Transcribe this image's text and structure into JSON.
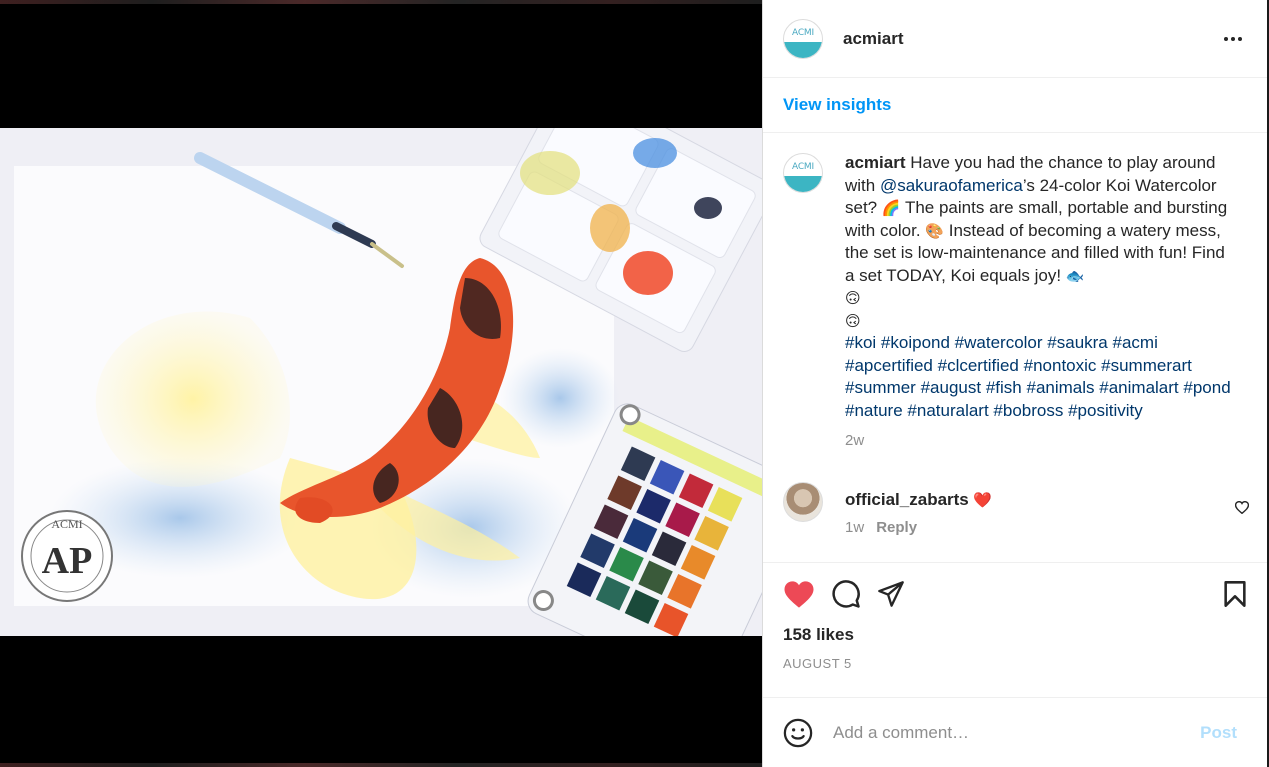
{
  "account": {
    "username": "acmiart",
    "avatar_text": "ACMI"
  },
  "insights": {
    "label": "View insights"
  },
  "caption": {
    "username": "acmiart",
    "text_1": " Have you had the chance to play around with ",
    "mention": "@sakuraofamerica",
    "text_2": "’s 24-color Koi Watercolor set? ",
    "emoji_rainbow": "🌈",
    "text_3": " The paints are small, portable and bursting with color. ",
    "emoji_palette": "🎨",
    "text_4": " Instead of becoming a watery mess, the set is low-maintenance and filled with fun! Find a set TODAY, Koi equals joy! ",
    "emoji_fish": "🐟",
    "emoji_line_1": "🙃",
    "emoji_line_2": "🙃",
    "hashtags": [
      "#koi",
      "#koipond",
      "#watercolor",
      "#saukra",
      "#acmi",
      "#apcertified",
      "#clcertified",
      "#nontoxic",
      "#summerart",
      "#summer",
      "#august",
      "#fish",
      "#animals",
      "#animalart",
      "#pond",
      "#nature",
      "#naturalart",
      "#bobross",
      "#positivity"
    ],
    "time_ago": "2w"
  },
  "comment": {
    "username": "official_zabarts",
    "text": "❤️",
    "time_ago": "1w",
    "reply_label": "Reply"
  },
  "post": {
    "likes": "158 likes",
    "date": "AUGUST 5"
  },
  "composer": {
    "placeholder": "Add a comment…",
    "post_label": "Post"
  },
  "media": {
    "seal_top": "ACMI",
    "seal_center": "AP"
  },
  "colors": {
    "link_blue": "#0095f6",
    "hashtag_navy": "#00376b",
    "like_red": "#ed4956",
    "post_disabled": "#b2dffc"
  }
}
